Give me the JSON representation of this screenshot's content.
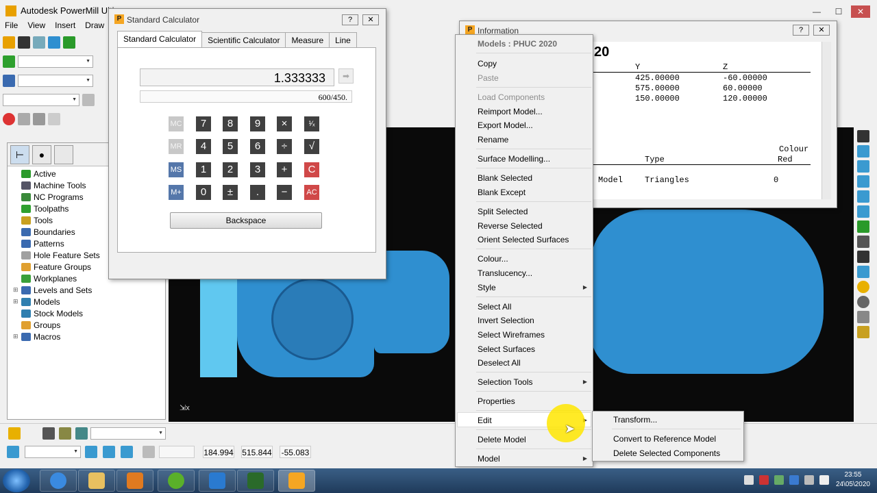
{
  "app": {
    "title": "Autodesk PowerMill Ultim",
    "menus": [
      "File",
      "View",
      "Insert",
      "Draw"
    ]
  },
  "explorer": {
    "items": [
      {
        "label": "Active",
        "expandable": false,
        "color": "#2a9a2a"
      },
      {
        "label": "Machine Tools",
        "expandable": false,
        "color": "#556"
      },
      {
        "label": "NC Programs",
        "expandable": false,
        "color": "#3a8a3a"
      },
      {
        "label": "Toolpaths",
        "expandable": false,
        "color": "#2ea02e"
      },
      {
        "label": "Tools",
        "expandable": false,
        "color": "#c8a020"
      },
      {
        "label": "Boundaries",
        "expandable": false,
        "color": "#3a6ab0"
      },
      {
        "label": "Patterns",
        "expandable": false,
        "color": "#3a6ab0"
      },
      {
        "label": "Hole Feature Sets",
        "expandable": false,
        "color": "#a0a0a0"
      },
      {
        "label": "Feature Groups",
        "expandable": false,
        "color": "#e0a030"
      },
      {
        "label": "Workplanes",
        "expandable": false,
        "color": "#3aa03a"
      },
      {
        "label": "Levels and Sets",
        "expandable": true,
        "color": "#3a6ab0"
      },
      {
        "label": "Models",
        "expandable": true,
        "color": "#2f7fb0"
      },
      {
        "label": "Stock Models",
        "expandable": false,
        "color": "#2f7fb0"
      },
      {
        "label": "Groups",
        "expandable": false,
        "color": "#e0a030"
      },
      {
        "label": "Macros",
        "expandable": true,
        "color": "#3a6ab0"
      }
    ]
  },
  "calculator": {
    "title": "Standard Calculator",
    "help_label": "?",
    "close_label": "✕",
    "tabs": [
      "Standard Calculator",
      "Scientific Calculator",
      "Measure",
      "Line"
    ],
    "display": "1.333333",
    "expression": "600/450.",
    "eval_arrow": "➡",
    "keys": {
      "mc": "MC",
      "mr": "MR",
      "ms": "MS",
      "mplus": "M+",
      "k7": "7",
      "k8": "8",
      "k9": "9",
      "times": "×",
      "recip": "¹⁄ₓ",
      "k4": "4",
      "k5": "5",
      "k6": "6",
      "divide": "÷",
      "sqrt": "√",
      "k1": "1",
      "k2": "2",
      "k3": "3",
      "plus": "+",
      "clear": "C",
      "k0": "0",
      "sign": "±",
      "point": ".",
      "minus": "−",
      "allclear": "AC"
    },
    "backspace_label": "Backspace"
  },
  "info": {
    "title": "Information",
    "help_label": "?",
    "close_label": "✕",
    "heading_suffix": "20",
    "col_y": "Y",
    "col_z": "Z",
    "rows": [
      {
        "y": "425.00000",
        "z": "-60.00000"
      },
      {
        "y": "575.00000",
        "z": "60.00000"
      },
      {
        "y": "150.00000",
        "z": "120.00000"
      }
    ],
    "colour_label": "Colour",
    "type_label": "Type",
    "red_label": "Red",
    "entity": "Model",
    "entity_type": "Triangles",
    "red_value": "0"
  },
  "context_menu": {
    "header": "Models : PHUC 2020",
    "items": {
      "copy": "Copy",
      "paste": "Paste",
      "load_components": "Load Components",
      "reimport": "Reimport Model...",
      "export": "Export Model...",
      "rename": "Rename",
      "surface_modelling": "Surface Modelling...",
      "blank_selected": "Blank Selected",
      "blank_except": "Blank Except",
      "split_selected": "Split Selected",
      "reverse_selected": "Reverse Selected",
      "orient_selected": "Orient Selected Surfaces",
      "colour": "Colour...",
      "translucency": "Translucency...",
      "style": "Style",
      "select_all": "Select All",
      "invert_selection": "Invert Selection",
      "select_wireframes": "Select Wireframes",
      "select_surfaces": "Select Surfaces",
      "deselect_all": "Deselect All",
      "selection_tools": "Selection Tools",
      "properties": "Properties",
      "edit": "Edit",
      "delete_model": "Delete Model",
      "model": "Model"
    },
    "submenu_arrow": "▶"
  },
  "edit_submenu": {
    "transform": "Transform...",
    "convert_reference": "Convert to Reference Model",
    "delete_components": "Delete Selected Components"
  },
  "status": {
    "x": "184.994",
    "y": "515.844",
    "z": "-55.083"
  },
  "window_controls": {
    "minimize": "—",
    "maximize": "☐",
    "close": "✕"
  },
  "viewport": {
    "axis": "x"
  },
  "taskbar": {
    "time": "23:55",
    "date": "24\\05\\2020"
  },
  "colors": {
    "model_blue": "#2f8fd0",
    "viewport_bg": "#0a0a0a",
    "calc_dark_key": "#404040",
    "calc_red_key": "#d04848",
    "calc_mem_key": "#5577aa",
    "cursor_highlight": "#ffe600"
  }
}
